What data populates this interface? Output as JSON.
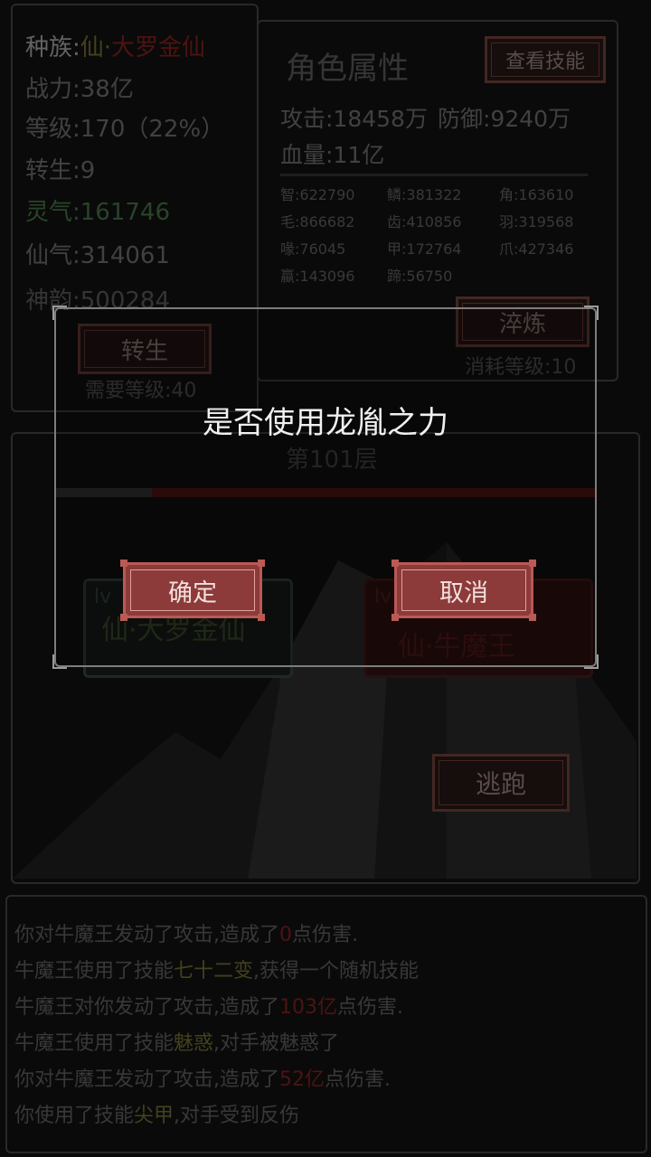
{
  "character": {
    "race_label": "种族:",
    "race_prefix": "仙·",
    "race_value": "大罗金仙",
    "power": "战力:38亿",
    "level": "等级:170（22%）",
    "rebirth": "转生:9",
    "lingqi": "灵气:161746",
    "xianqi": "仙气:314061",
    "shenyun": "神韵:500284",
    "rebirth_button": "转生",
    "rebirth_requirement": "需要等级:40"
  },
  "attributes": {
    "title": "角色属性",
    "view_skills_button": "查看技能",
    "attack": "攻击:18458万",
    "defense": "防御:9240万",
    "hp": "血量:11亿",
    "stats": [
      "智:622790",
      "鳞:381322",
      "角:163610",
      "毛:866682",
      "齿:410856",
      "羽:319568",
      "喙:76045",
      "甲:172764",
      "爪:427346",
      "蠃:143096",
      "蹄:56750"
    ],
    "refine_button": "淬炼",
    "refine_cost": "消耗等级:10"
  },
  "battle": {
    "floor": "第101层",
    "player_lv_prefix": "lv",
    "player_name": "仙·大罗金仙",
    "enemy_lv_prefix": "lv",
    "enemy_name": "仙·牛魔王",
    "flee_button": "逃跑"
  },
  "log": [
    {
      "a": "你对牛魔王发动了攻击,造成了",
      "h": "0",
      "b": "点伤害."
    },
    {
      "a": "牛魔王使用了技能",
      "h": "七十二变",
      "b": ",获得一个随机技能"
    },
    {
      "a": "牛魔王对你发动了攻击,造成了",
      "h": "103亿",
      "b": "点伤害."
    },
    {
      "a": "牛魔王使用了技能",
      "h": "魅惑",
      "b": ",对手被魅惑了"
    },
    {
      "a": "你对牛魔王发动了攻击,造成了",
      "h": "52亿",
      "b": "点伤害."
    },
    {
      "a": "你使用了技能",
      "h": "尖甲",
      "b": ",对手受到反伤"
    }
  ],
  "dialog": {
    "message": "是否使用龙胤之力",
    "confirm": "确定",
    "cancel": "取消"
  }
}
